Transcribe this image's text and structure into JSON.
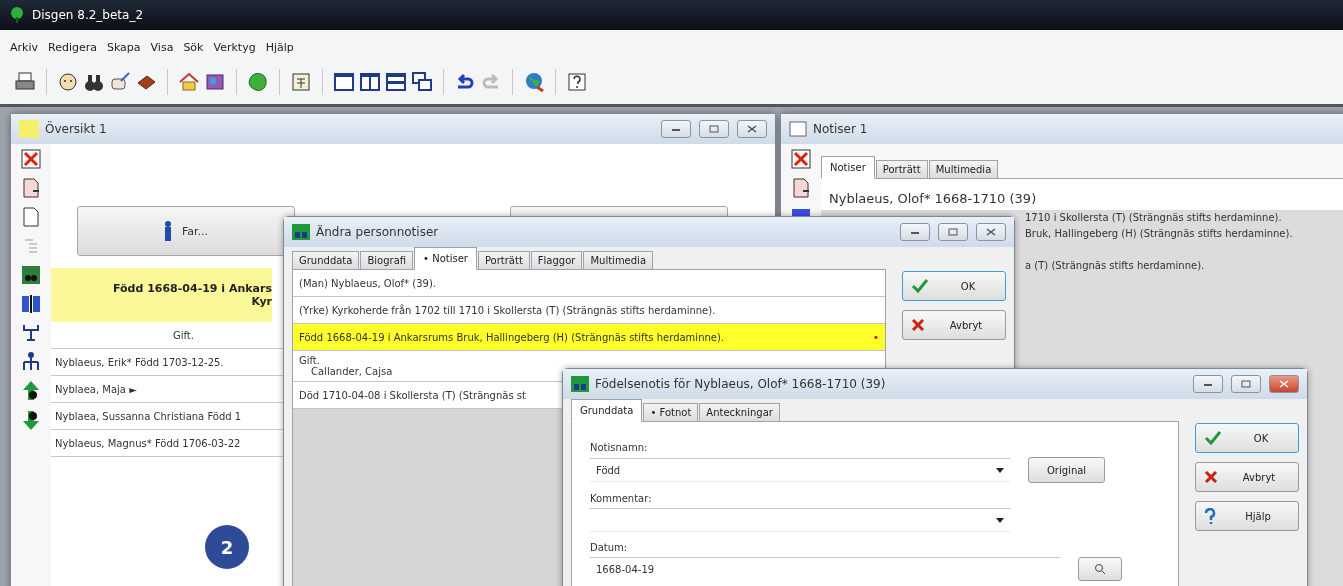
{
  "app": {
    "title": "Disgen 8.2_beta_2"
  },
  "menu": [
    "Arkiv",
    "Redigera",
    "Skapa",
    "Visa",
    "Sök",
    "Verktyg",
    "Hjälp"
  ],
  "overview": {
    "title": "Översikt 1",
    "father_button": "Far...",
    "highlight": [
      "Född 1668-04-19 i Ankars",
      "Kyr"
    ],
    "marriage": "Gift.",
    "children": [
      "Nyblaeus, Erik* Född 1703-12-25.",
      "Nyblaea, Maja ►",
      "Nyblaea, Sussanna Christiana Född 1",
      "Nyblaeus, Magnus* Född 1706-03-22"
    ]
  },
  "notes_window": {
    "title": "Notiser 1",
    "tabs": [
      {
        "label": "Notiser",
        "selected": true
      },
      {
        "label": "Porträtt",
        "selected": false
      },
      {
        "label": "Multimedia",
        "selected": false
      }
    ],
    "heading": "Nyblaeus, Olof* 1668-1710 (39)",
    "lines": [
      {
        "text": "1710 i Skollersta (T) (Strängnäs stifts herdaminne)."
      },
      {
        "text": "Bruk, Hallingeberg (H) (Strängnäs stifts herdaminne)."
      },
      {
        "text": "a (T) (Strängnäs stifts herdaminne).",
        "blank_before": true
      }
    ]
  },
  "edit_dialog": {
    "title": "Ändra personnotiser",
    "tabs": [
      {
        "label": "Grunddata",
        "selected": false
      },
      {
        "label": "Biografi",
        "selected": false
      },
      {
        "label": "•  Notiser",
        "selected": true
      },
      {
        "label": "Porträtt",
        "selected": false
      },
      {
        "label": "Flaggor",
        "selected": false
      },
      {
        "label": "Multimedia",
        "selected": false
      }
    ],
    "notes": [
      {
        "lines": [
          "(Man) Nyblaeus, Olof* (39)."
        ],
        "selected": false
      },
      {
        "lines": [
          "(Yrke) Kyrkoherde från 1702 till 1710 i Skollersta (T) (Strängnäs stifts herdaminne)."
        ],
        "selected": false
      },
      {
        "lines": [
          "Född 1668-04-19 i Ankarsrums Bruk, Hallingeberg (H) (Strängnäs stifts herdaminne)."
        ],
        "selected": true,
        "marker": "•"
      },
      {
        "lines": [
          "Gift.",
          "Callander, Cajsa"
        ],
        "selected": false
      },
      {
        "lines": [
          "Död 1710-04-08 i Skollersta (T) (Strängnäs st"
        ],
        "selected": false
      }
    ],
    "buttons": [
      {
        "kind": "ok",
        "label": "OK"
      },
      {
        "kind": "cancel",
        "label": "Avbryt"
      }
    ]
  },
  "birth_dialog": {
    "title": "Födelsenotis för Nyblaeus, Olof* 1668-1710 (39)",
    "tabs": [
      {
        "label": "Grunddata",
        "selected": true
      },
      {
        "label": "•  Fotnot",
        "selected": false
      },
      {
        "label": "Anteckningar",
        "selected": false
      }
    ],
    "fields": [
      {
        "kind": "dropdown",
        "label": "Notisnamn:",
        "value": "Född"
      },
      {
        "kind": "dropdown",
        "label": "Kommentar:"
      },
      {
        "kind": "text",
        "label": "Datum:",
        "value": "1668-04-19"
      }
    ],
    "original_button": "Original",
    "buttons": [
      {
        "kind": "ok",
        "label": "OK"
      },
      {
        "kind": "cancel",
        "label": "Avbryt"
      },
      {
        "kind": "help",
        "label": "Hjälp"
      }
    ]
  },
  "badge": "2"
}
